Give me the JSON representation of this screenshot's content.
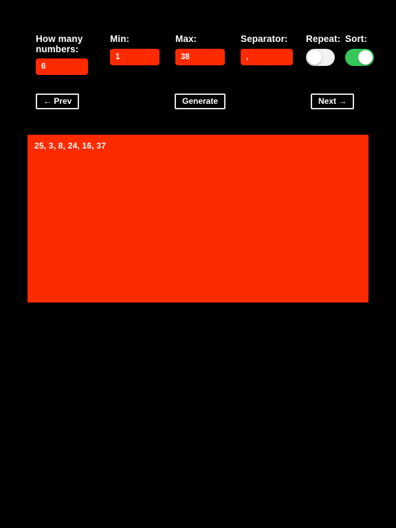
{
  "theme": {
    "background": "#000000",
    "accent_red": "#ff2b00",
    "toggle_on_green": "#34c759",
    "toggle_off_track": "#f2f2f2",
    "text": "#ffffff",
    "button_border": "#e6e6e6"
  },
  "form": {
    "fields": [
      {
        "label": "How many\nnumbers:",
        "value": "6"
      },
      {
        "label": "Min:",
        "value": "1"
      },
      {
        "label": "Max:",
        "value": "38"
      },
      {
        "label": "Separator:",
        "value": ","
      }
    ],
    "toggles": [
      {
        "label": "Repeat:",
        "state": "off",
        "checked": false
      },
      {
        "label": "Sort:",
        "state": "on",
        "checked": true
      }
    ]
  },
  "buttons": {
    "prev": "← Prev",
    "generate": "Generate",
    "next": "Next →"
  },
  "output": {
    "result": "25, 3, 8, 24, 16, 37"
  }
}
